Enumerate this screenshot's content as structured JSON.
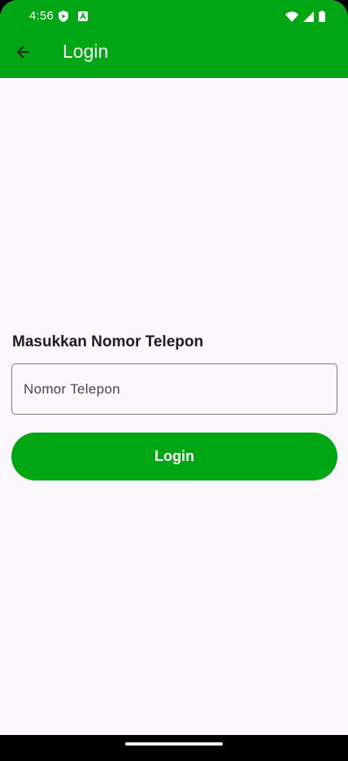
{
  "status_bar": {
    "time": "4:56",
    "left_icons": [
      "shield-play-icon",
      "a-box-icon"
    ],
    "right_icons": [
      "wifi-icon",
      "signal-icon",
      "battery-icon"
    ]
  },
  "app_bar": {
    "title": "Login",
    "back_icon": "arrow-back-icon"
  },
  "form": {
    "label": "Masukkan Nomor Telepon",
    "phone_placeholder": "Nomor Telepon",
    "phone_value": "",
    "submit_label": "Login"
  },
  "colors": {
    "primary": "#00a613",
    "background": "#fcf6fd",
    "text": "#1d1b20"
  }
}
